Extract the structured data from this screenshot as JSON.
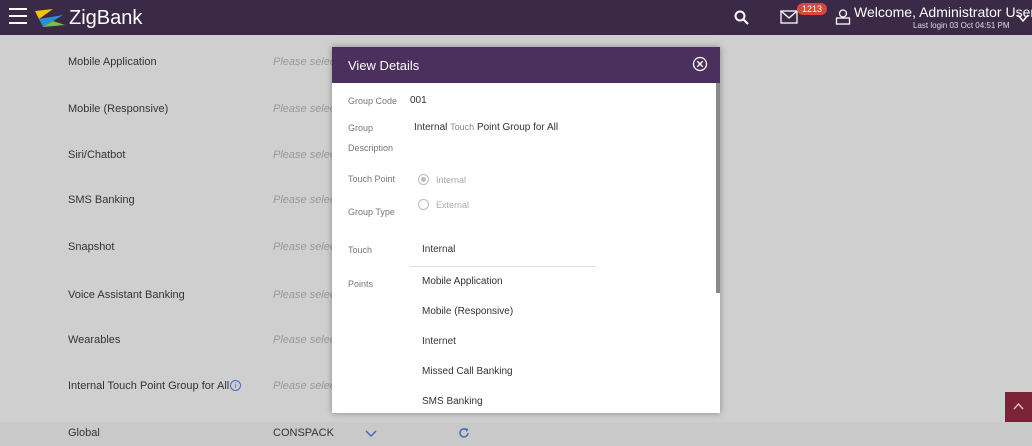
{
  "header": {
    "brand": "ZigBank",
    "mail_count": "1213",
    "welcome": "Welcome, Administrator User",
    "last_login": "Last login 03 Oct 04:51 PM",
    "icons": [
      "hamburger-icon",
      "search-icon",
      "mail-icon",
      "user-icon",
      "chevron-down-icon"
    ]
  },
  "rows": [
    {
      "label": "Mobile Application",
      "value": "Please select"
    },
    {
      "label": "Mobile (Responsive)",
      "value": "Please select"
    },
    {
      "label": "Siri/Chatbot",
      "value": "Please select"
    },
    {
      "label": "SMS Banking",
      "value": "Please select"
    },
    {
      "label": "Snapshot",
      "value": "Please select"
    },
    {
      "label": "Voice Assistant Banking",
      "value": "Please select"
    },
    {
      "label": "Wearables",
      "value": "Please select"
    },
    {
      "label": "Internal Touch Point Group for All",
      "value": "Please select"
    }
  ],
  "global_row": {
    "label": "Global",
    "value": "CONSPACK"
  },
  "modal": {
    "title": "View Details",
    "group_code_label": "Group Code",
    "group_code": "001",
    "group_desc_label_1": "Group",
    "group_desc_label_2": "Description",
    "desc_part1": "Internal",
    "desc_part2": "Touch",
    "desc_part3": "Point Group for All",
    "tp_type_label_1": "Touch Point",
    "tp_type_label_2": "Group Type",
    "option_internal": "Internal",
    "option_external": "External",
    "tp_label_1": "Touch",
    "tp_label_2": "Points",
    "tp_header": "Internal",
    "touch_points": [
      "Mobile Application",
      "Mobile (Responsive)",
      "Internet",
      "Missed Call Banking",
      "SMS Banking"
    ]
  },
  "colors": {
    "header_bg": "#3a2a47",
    "modal_header": "#4b2f5d",
    "badge": "#d9483b",
    "accent": "#7a2236"
  }
}
